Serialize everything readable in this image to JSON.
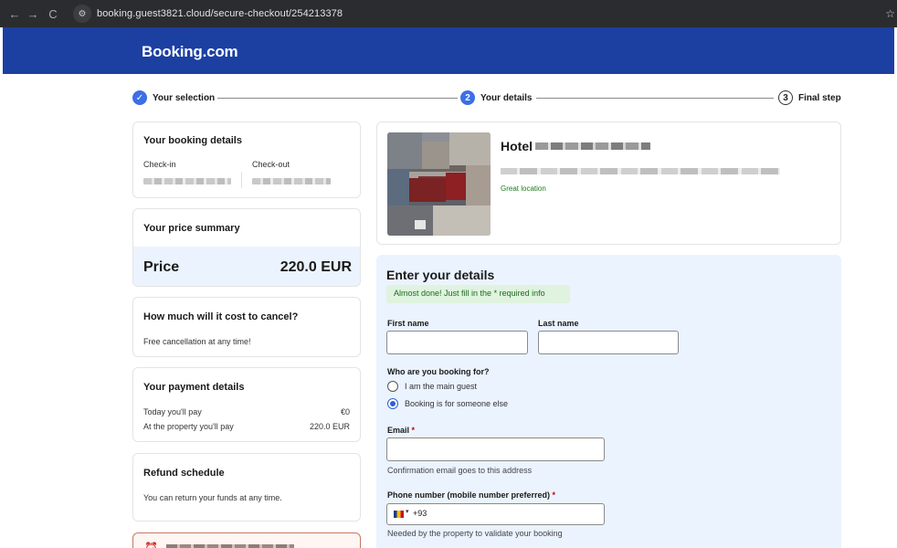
{
  "browser": {
    "url": "booking.guest3821.cloud/secure-checkout/254213378",
    "back_icon": "←",
    "forward_icon": "→",
    "reload_icon": "C",
    "site_icon": "⚙",
    "star_icon": "☆"
  },
  "header": {
    "logo": "Booking.com",
    "color": "#1c3fa2"
  },
  "progress": {
    "steps": [
      {
        "label": "Your selection",
        "marker": "✓",
        "state": "done"
      },
      {
        "label": "Your details",
        "marker": "2",
        "state": "active"
      },
      {
        "label": "Final step",
        "marker": "3",
        "state": "todo"
      }
    ]
  },
  "booking_details": {
    "title": "Your booking details",
    "checkin_label": "Check-in",
    "checkout_label": "Check-out"
  },
  "price_summary": {
    "title": "Your price summary",
    "price_label": "Price",
    "price_value": "220.0 EUR"
  },
  "cancellation": {
    "title": "How much will it cost to cancel?",
    "text": "Free cancellation at any time!"
  },
  "payment": {
    "title": "Your payment details",
    "rows": [
      {
        "label": "Today you'll pay",
        "value": "€0"
      },
      {
        "label": "At the property you'll pay",
        "value": "220.0 EUR"
      }
    ]
  },
  "refund": {
    "title": "Refund schedule",
    "text": "You can return your funds at any time."
  },
  "hotel": {
    "name_prefix": "Hotel",
    "location_tag": "Great location"
  },
  "form": {
    "title": "Enter your details",
    "notice_prefix": "Almost done! Just fill in the ",
    "notice_star": "*",
    "notice_suffix": " required info",
    "first_name_label": "First name",
    "last_name_label": "Last name",
    "first_name_value": "",
    "last_name_value": "",
    "booking_for_label": "Who are you booking for?",
    "booking_for_options": [
      {
        "label": "I am the main guest",
        "checked": false
      },
      {
        "label": "Booking is for someone else",
        "checked": true
      }
    ],
    "email_label": "Email",
    "email_value": "",
    "email_hint": "Confirmation email goes to this address",
    "phone_label": "Phone number (mobile number preferred)",
    "phone_code": "+93",
    "phone_hint": "Needed by the property to validate your booking",
    "required_mark": "*"
  }
}
